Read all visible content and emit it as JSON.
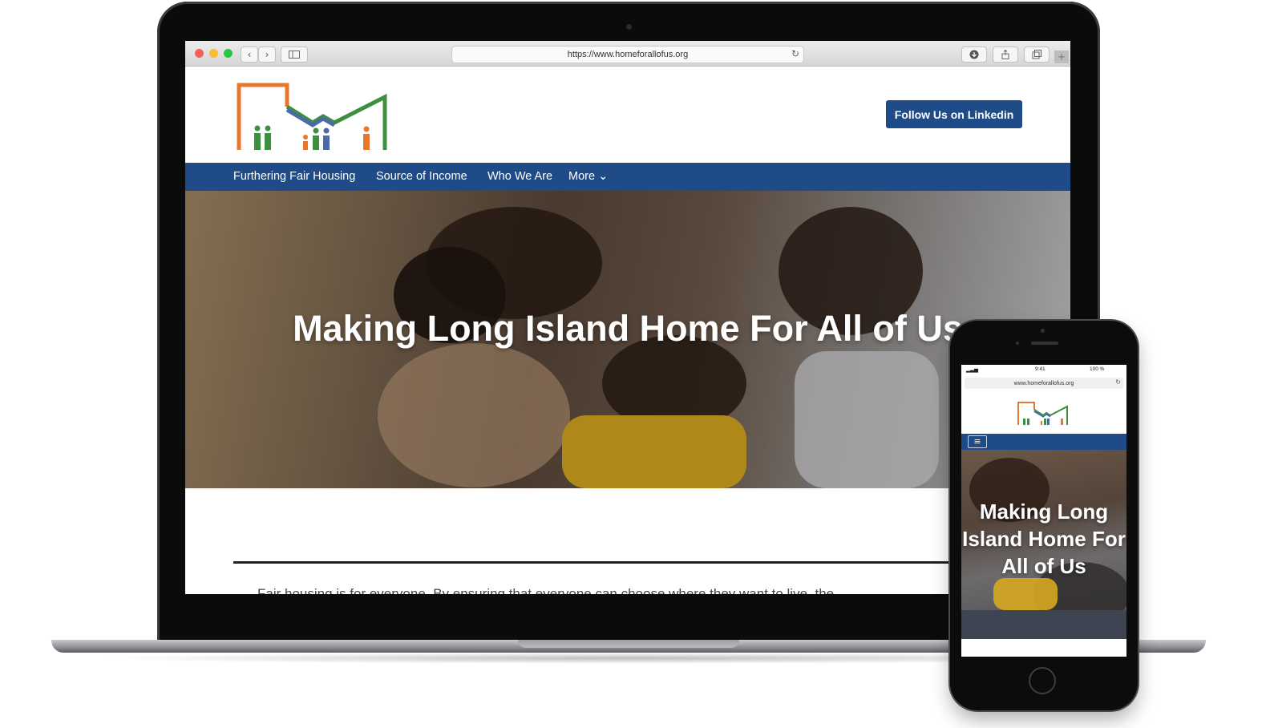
{
  "browser": {
    "url": "https://www.homeforallofus.org",
    "back_icon": "chevron-left-icon",
    "forward_icon": "chevron-right-icon",
    "sidebar_icon": "sidebar-icon",
    "reload_icon": "reload-icon",
    "download_icon": "download-icon",
    "share_icon": "share-icon",
    "tabs_icon": "tabs-icon",
    "new_tab_icon": "plus-icon"
  },
  "header": {
    "follow_label": "Follow Us on Linkedin"
  },
  "nav": {
    "items": [
      {
        "label": "Furthering Fair Housing"
      },
      {
        "label": "Source of Income"
      },
      {
        "label": "Who We Are"
      },
      {
        "label": "More ⌄"
      }
    ]
  },
  "hero": {
    "title": "Making Long Island Home For All of Us"
  },
  "intro": {
    "text": "Fair housing is for everyone. By ensuring that everyone can choose where they want to live, the"
  },
  "mobile": {
    "time": "9:41",
    "battery": "100 %",
    "url": "www.homeforallofus.org",
    "menu_icon": "≡",
    "title": "Making Long Island Home For All of Us"
  },
  "colors": {
    "brand_blue": "#1f4b88",
    "logo_orange": "#e8762c",
    "logo_green": "#3c8f3e",
    "logo_blue": "#4a6aa8"
  }
}
